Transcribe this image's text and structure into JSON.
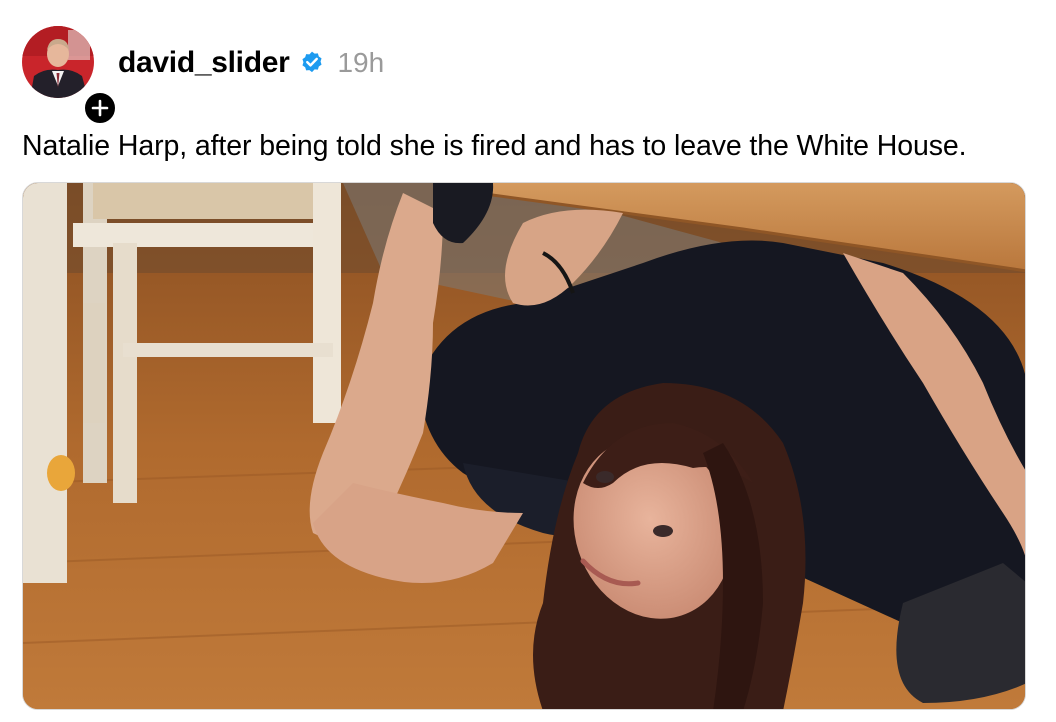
{
  "post": {
    "author": {
      "username": "david_slider",
      "verified": true,
      "avatar_icon": "avatar-photo",
      "follow_icon": "plus-icon"
    },
    "timestamp": "19h",
    "caption": "Natalie Harp, after being told she is fired and has to leave the White House.",
    "media": {
      "type": "image",
      "description_icon": "photo-woman-under-table"
    },
    "colors": {
      "verified": "#1d9bf0",
      "timestamp": "#9a9a9a",
      "text": "#000000"
    }
  }
}
